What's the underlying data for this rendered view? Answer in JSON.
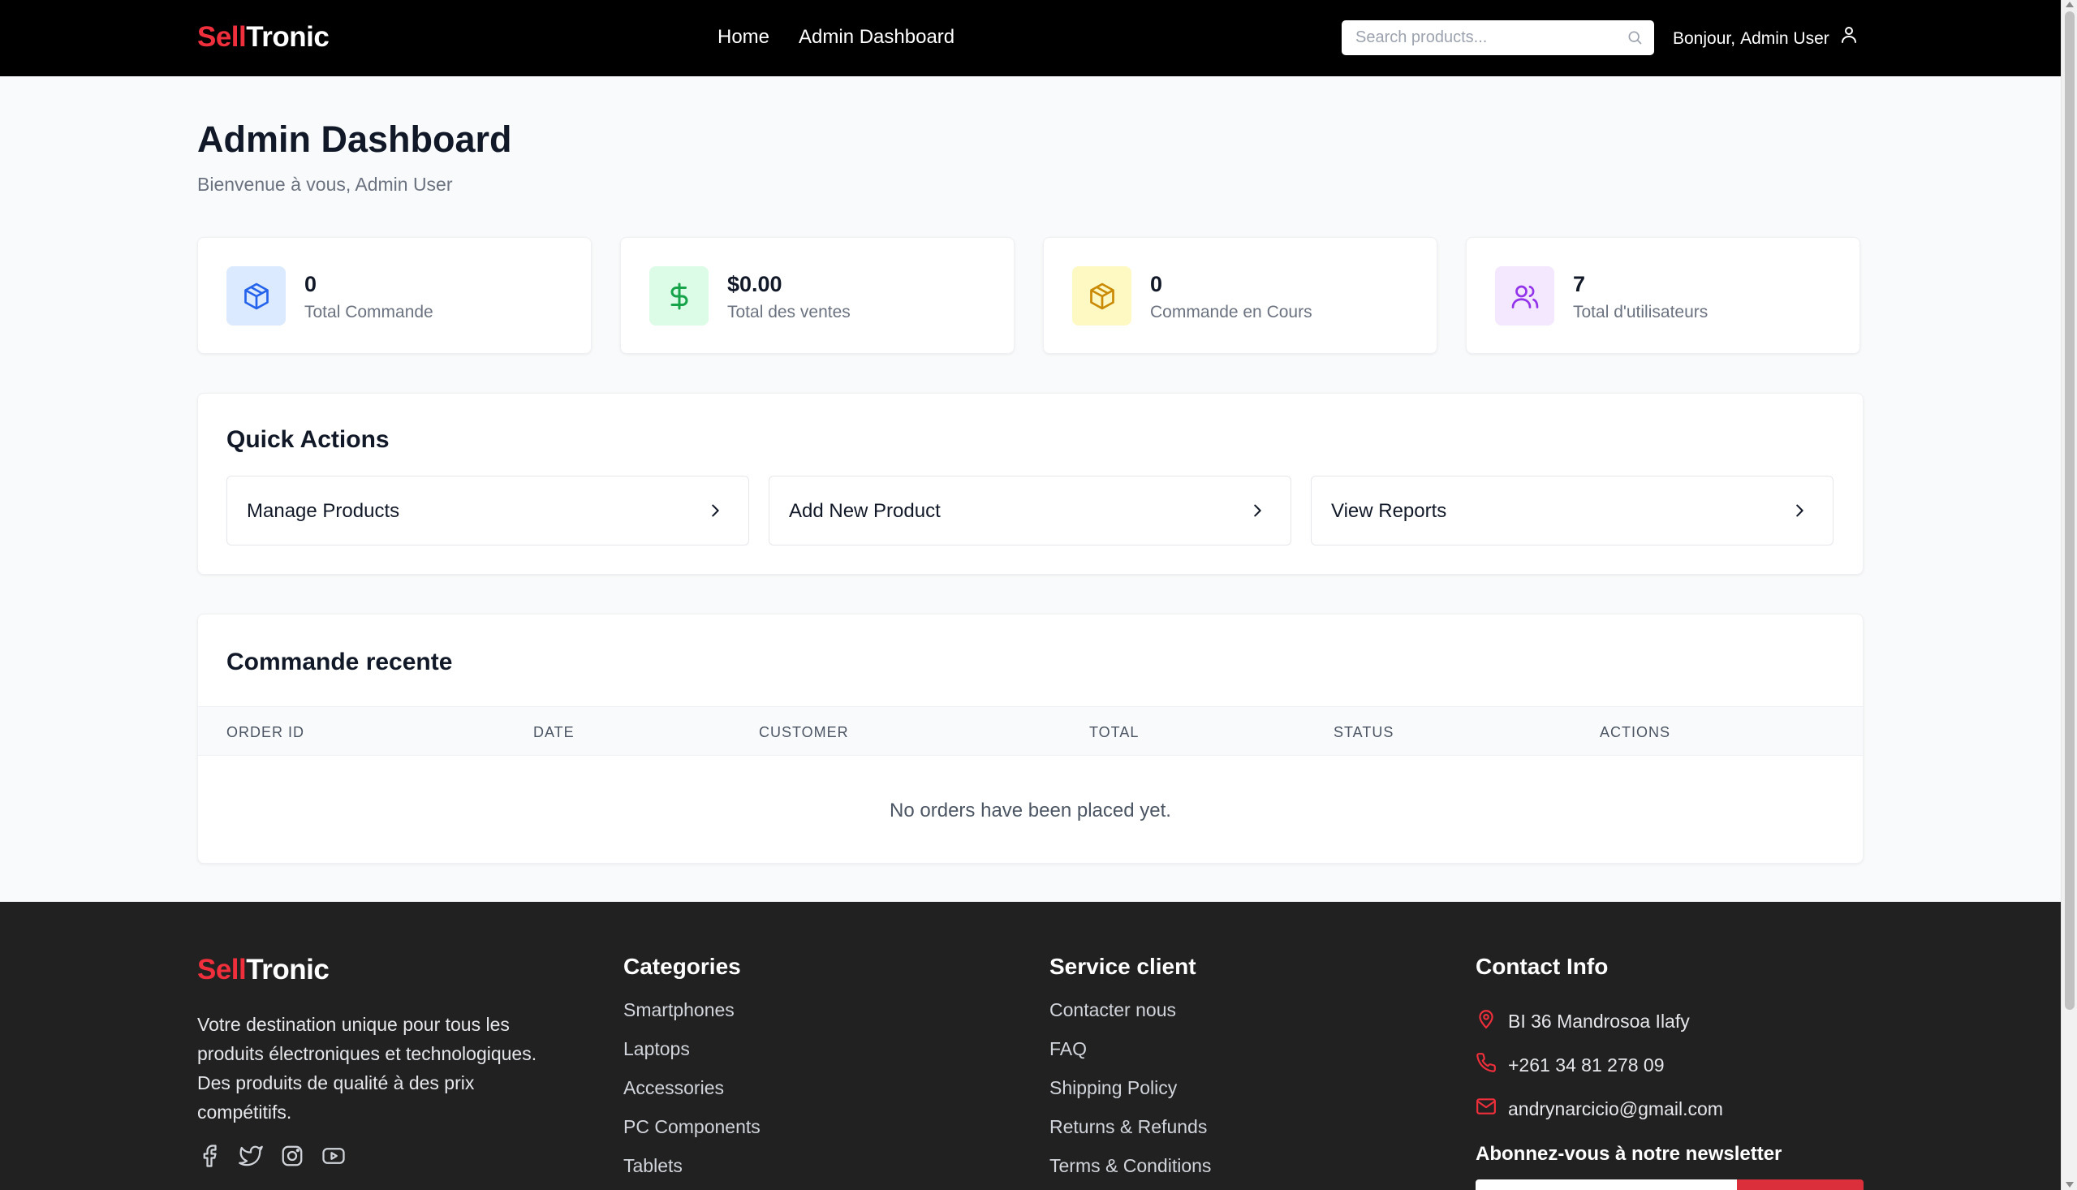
{
  "brand": {
    "part1": "Sell",
    "part2": "Tronic",
    "accent": "#ef2f3b"
  },
  "header": {
    "nav": [
      {
        "label": "Home"
      },
      {
        "label": "Admin Dashboard"
      }
    ],
    "search_placeholder": "Search products...",
    "greeting_prefix": "Bonjour,",
    "user_name": "Admin User"
  },
  "main": {
    "title": "Admin Dashboard",
    "subtitle": "Bienvenue à vous, Admin User",
    "stats": [
      {
        "value": "0",
        "label": "Total Commande",
        "icon": "package-icon",
        "color": "#2563eb",
        "bg": "#dbeafe"
      },
      {
        "value": "$0.00",
        "label": "Total des ventes",
        "icon": "dollar-icon",
        "color": "#16a34a",
        "bg": "#dcfce7"
      },
      {
        "value": "0",
        "label": "Commande en Cours",
        "icon": "package-icon",
        "color": "#ca8a04",
        "bg": "#fef9c3"
      },
      {
        "value": "7",
        "label": "Total d'utilisateurs",
        "icon": "users-icon",
        "color": "#9333ea",
        "bg": "#f3e8ff"
      }
    ],
    "quick_actions": {
      "title": "Quick Actions",
      "items": [
        {
          "label": "Manage Products"
        },
        {
          "label": "Add New Product"
        },
        {
          "label": "View Reports"
        }
      ]
    },
    "recent_orders": {
      "title": "Commande recente",
      "columns": [
        "ORDER ID",
        "DATE",
        "CUSTOMER",
        "TOTAL",
        "STATUS",
        "ACTIONS"
      ],
      "empty_message": "No orders have been placed yet."
    }
  },
  "footer": {
    "description": "Votre destination unique pour tous les produits électroniques et technologiques. Des produits de qualité à des prix compétitifs.",
    "social": [
      "facebook-icon",
      "twitter-icon",
      "instagram-icon",
      "youtube-icon"
    ],
    "categories": {
      "title": "Categories",
      "items": [
        "Smartphones",
        "Laptops",
        "Accessories",
        "PC Components",
        "Tablets"
      ]
    },
    "service": {
      "title": "Service client",
      "items": [
        "Contacter nous",
        "FAQ",
        "Shipping Policy",
        "Returns & Refunds",
        "Terms & Conditions"
      ]
    },
    "contact": {
      "title": "Contact Info",
      "address": "BI 36 Mandrosoa Ilafy",
      "phone": "+261 34 81 278 09",
      "email": "andrynarcicio@gmail.com"
    },
    "newsletter_title": "Abonnez-vous à notre newsletter"
  }
}
